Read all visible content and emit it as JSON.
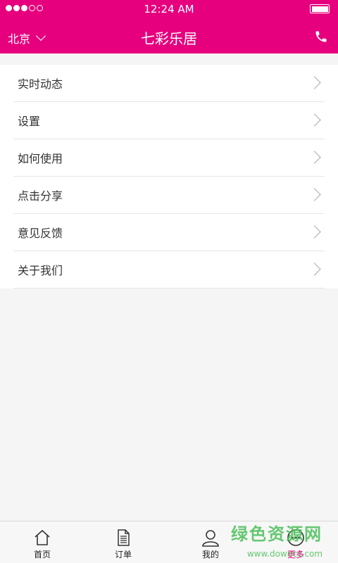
{
  "status_bar": {
    "time": "12:24 AM"
  },
  "header": {
    "city": "北京",
    "title": "七彩乐居"
  },
  "menu": {
    "items": [
      {
        "label": "实时动态"
      },
      {
        "label": "设置"
      },
      {
        "label": "如何使用"
      },
      {
        "label": "点击分享"
      },
      {
        "label": "意见反馈"
      },
      {
        "label": "关于我们"
      }
    ]
  },
  "tabbar": {
    "tabs": [
      {
        "label": "首页",
        "icon": "home-icon"
      },
      {
        "label": "订单",
        "icon": "document-icon"
      },
      {
        "label": "我的",
        "icon": "user-icon"
      },
      {
        "label": "更多",
        "icon": "more-icon"
      }
    ],
    "active_index": 3
  },
  "watermark": {
    "text": "绿色资源网",
    "sub": "www.downcc.com"
  },
  "colors": {
    "brand": "#e6007e",
    "watermark": "#4bbf5a"
  }
}
